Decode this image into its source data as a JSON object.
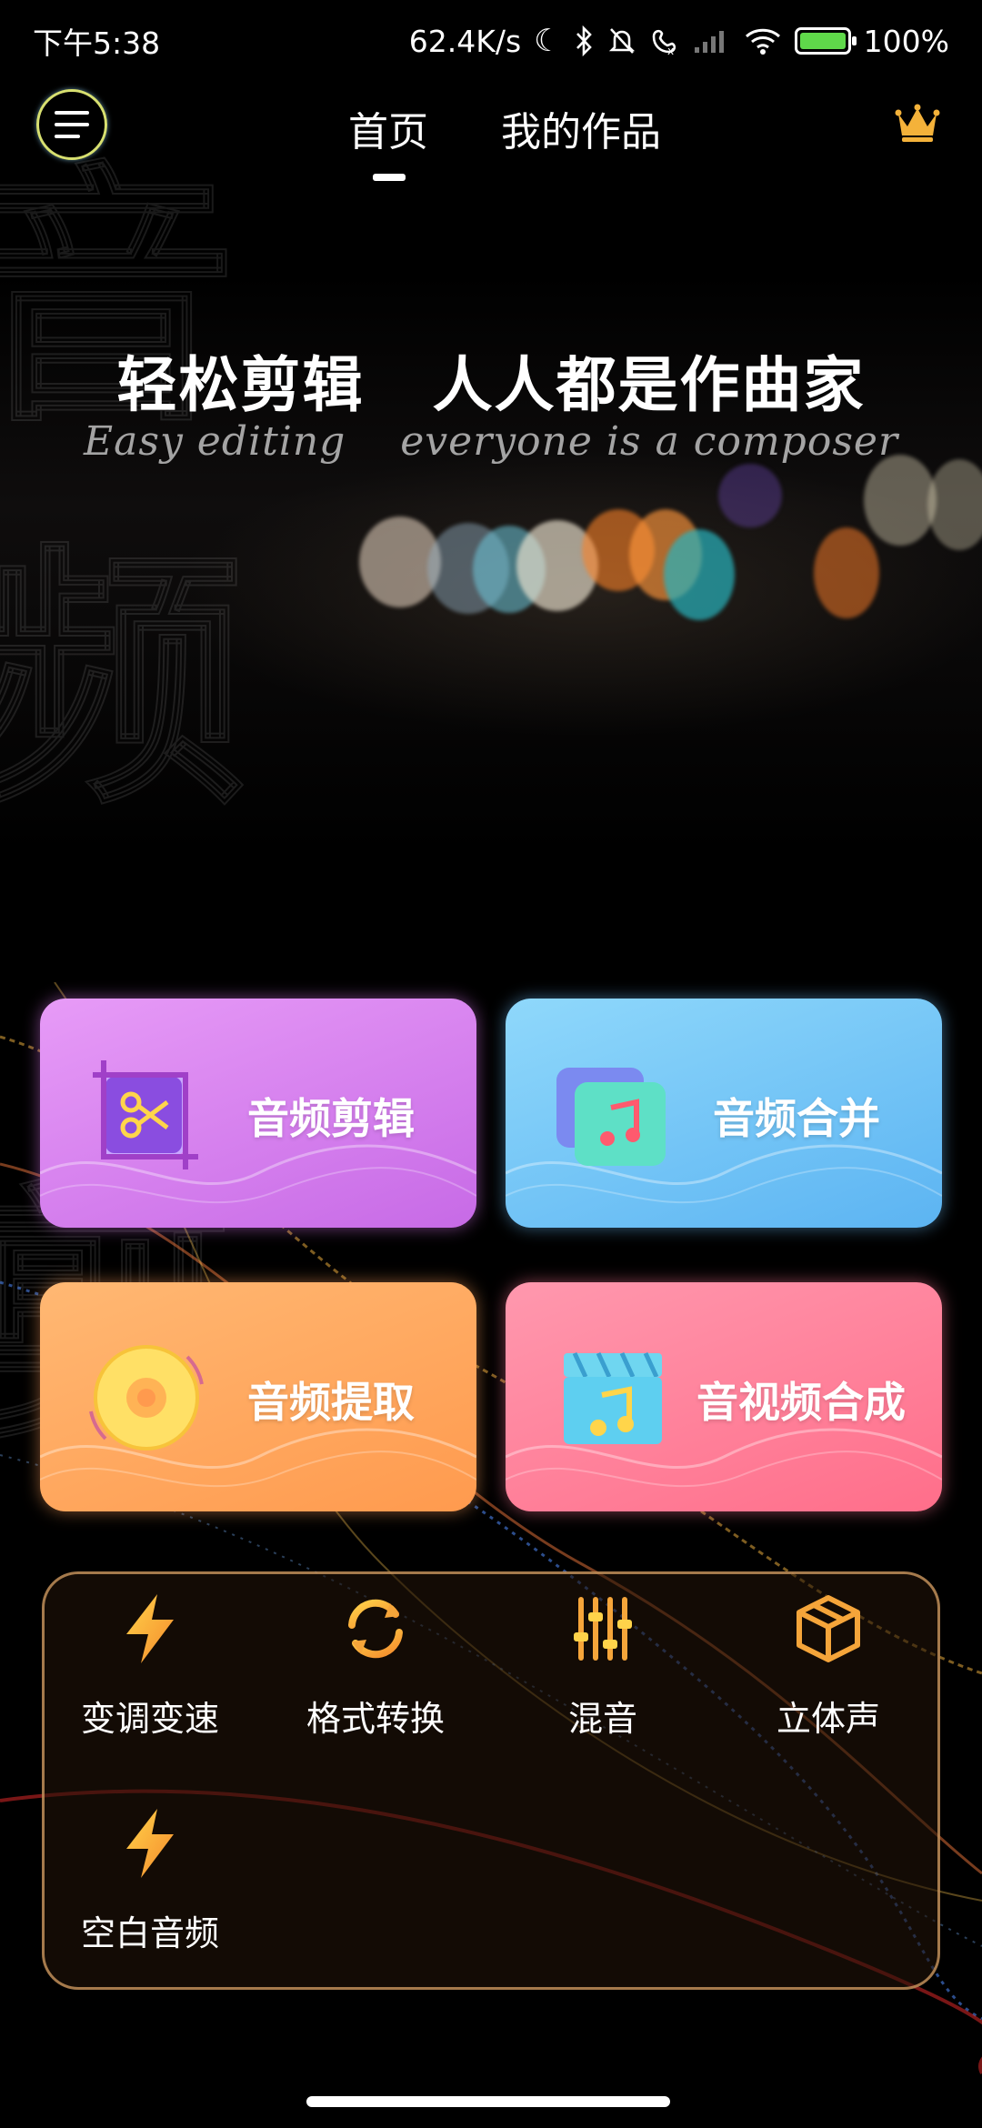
{
  "status_bar": {
    "time": "下午5:38",
    "net_speed": "62.4K/s",
    "battery": "100%",
    "battery_level": 1.0,
    "icons": [
      "moon-icon",
      "bluetooth-icon",
      "mute-icon",
      "call-off-icon",
      "signal-icon",
      "wifi-icon",
      "battery-icon"
    ]
  },
  "nav": {
    "menu_icon": "menu-icon",
    "tabs": [
      {
        "label": "首页",
        "active": true
      },
      {
        "label": "我的作品",
        "active": false
      }
    ],
    "vip_icon": "crown-icon"
  },
  "hero": {
    "title": "轻松剪辑   人人都是作曲家",
    "subtitle": "Easy editing    everyone is a composer"
  },
  "features": [
    {
      "label": "音频剪辑",
      "icon": "scissors-icon",
      "color": "#d27ff0"
    },
    {
      "label": "音频合并",
      "icon": "music-merge-icon",
      "color": "#6fc6f5"
    },
    {
      "label": "音频提取",
      "icon": "disc-icon",
      "color": "#ffa860"
    },
    {
      "label": "音视频合成",
      "icon": "clapper-icon",
      "color": "#ff7b96"
    }
  ],
  "tools": [
    {
      "label": "变调变速",
      "icon": "bolt-icon"
    },
    {
      "label": "格式转换",
      "icon": "refresh-icon"
    },
    {
      "label": "混音",
      "icon": "sliders-icon"
    },
    {
      "label": "立体声",
      "icon": "cube-icon"
    },
    {
      "label": "空白音频",
      "icon": "bolt-icon"
    }
  ],
  "colors": {
    "accent_gold": "#f2a640",
    "panel_border": "#d7a064"
  }
}
